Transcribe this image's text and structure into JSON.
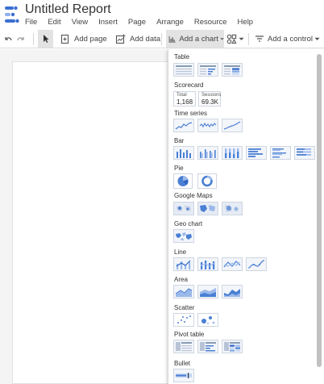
{
  "app": {
    "title": "Untitled Report",
    "menu": [
      "File",
      "Edit",
      "View",
      "Insert",
      "Page",
      "Arrange",
      "Resource",
      "Help"
    ]
  },
  "toolbar": {
    "add_page": "Add page",
    "add_data": "Add data",
    "add_chart": "Add a chart",
    "add_control": "Add a control"
  },
  "chart_menu": {
    "sections": {
      "table": "Table",
      "scorecard": "Scorecard",
      "time_series": "Time series",
      "bar": "Bar",
      "pie": "Pie",
      "google_maps": "Google Maps",
      "geo_chart": "Geo chart",
      "line": "Line",
      "area": "Area",
      "scatter": "Scatter",
      "pivot_table": "Pivot table",
      "bullet": "Bullet"
    },
    "scorecard_items": [
      {
        "label": "Total",
        "value": "1,168"
      },
      {
        "label": "Sessions",
        "value": "69.3K"
      }
    ]
  },
  "colors": {
    "accent": "#4a7fd4",
    "accent_light": "#9bb9ea",
    "active_button": "#e3e3e3",
    "logo_dark": "#3c6fd1",
    "logo_light": "#8eb0ee"
  }
}
